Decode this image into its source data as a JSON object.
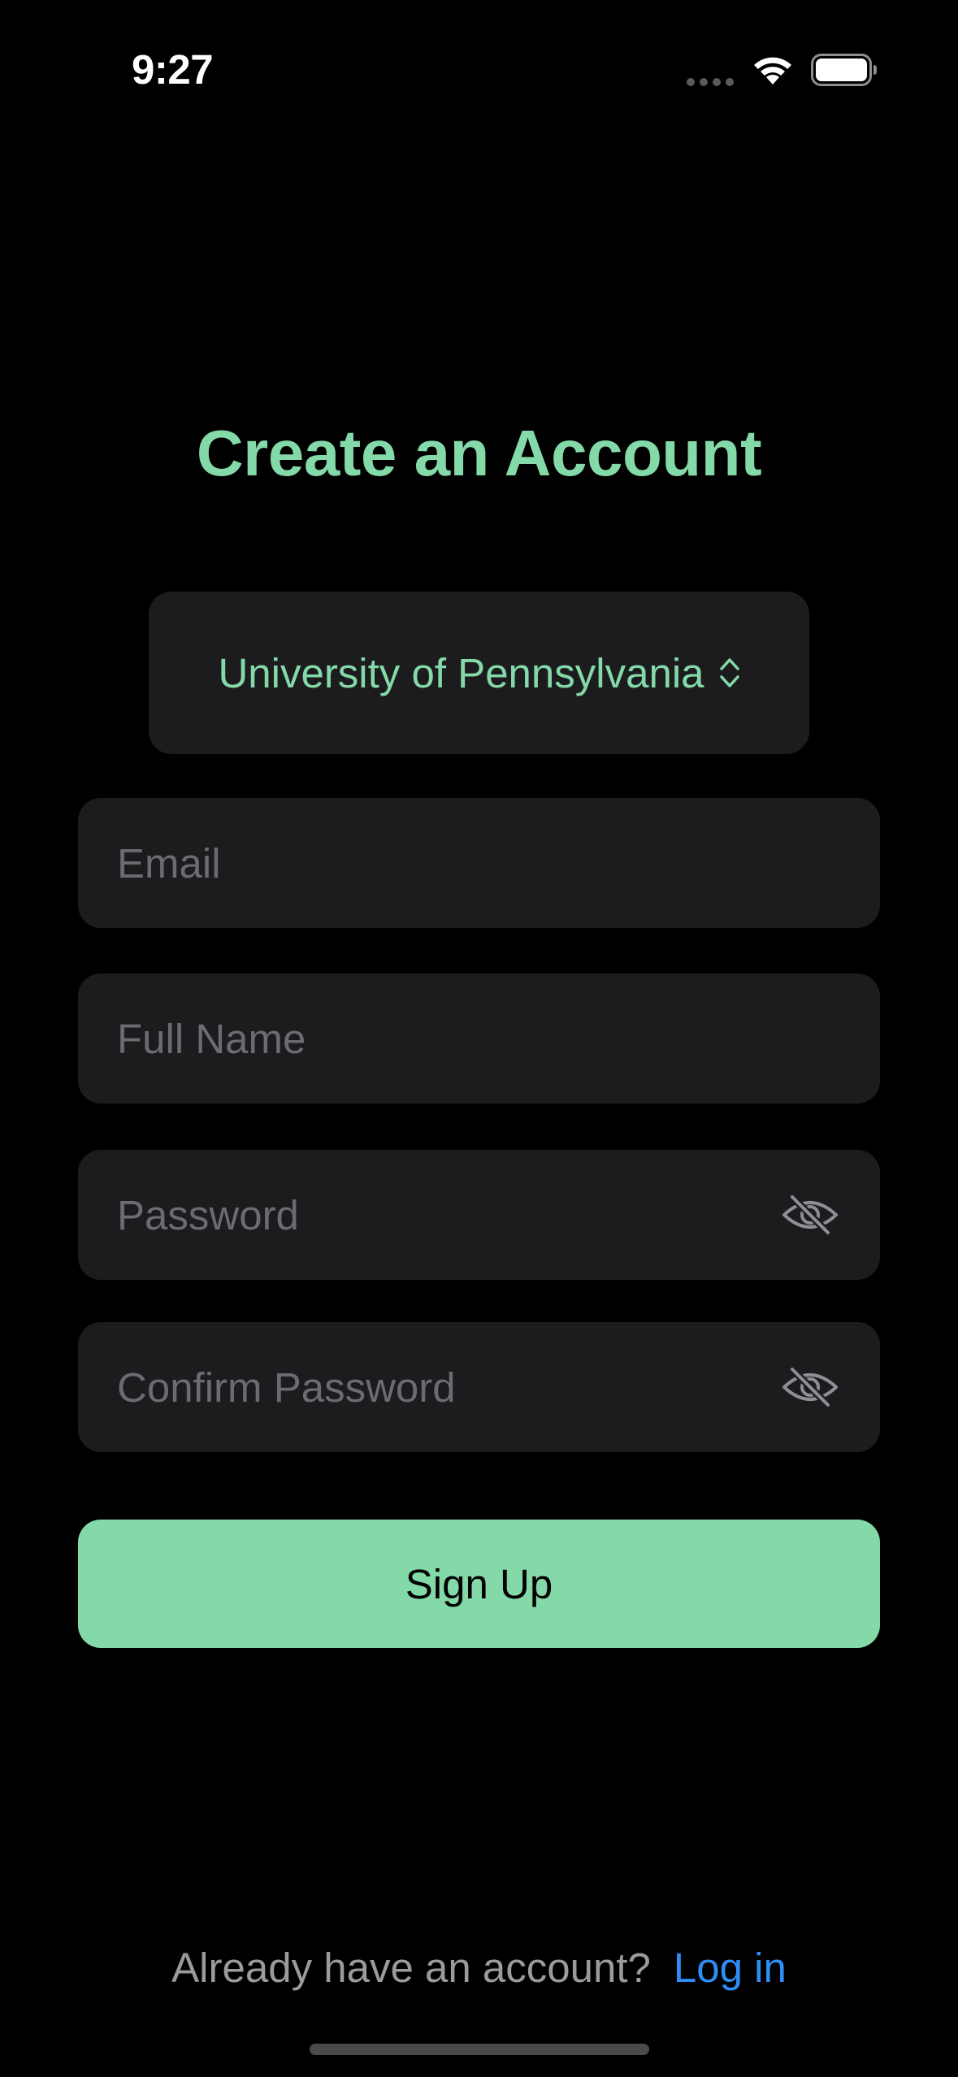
{
  "status_bar": {
    "time": "9:27",
    "signal_icon": "cellular-dots-icon",
    "wifi_icon": "wifi-icon",
    "battery_icon": "battery-icon"
  },
  "title": "Create an Account",
  "university_picker": {
    "value": "University of Pennsylvania",
    "icon": "chevron-up-down-icon"
  },
  "form": {
    "email_placeholder": "Email",
    "full_name_placeholder": "Full Name",
    "password_placeholder": "Password",
    "confirm_password_placeholder": "Confirm Password",
    "visibility_icon": "eye-slash-icon"
  },
  "signup_button": "Sign Up",
  "footer": {
    "prompt": "Already have an account?",
    "login_link": "Log in"
  },
  "colors": {
    "accent": "#84d9a8",
    "background": "#000000",
    "field_background": "#1c1c1e",
    "placeholder": "#6b6b70",
    "link": "#2f8ef5"
  }
}
